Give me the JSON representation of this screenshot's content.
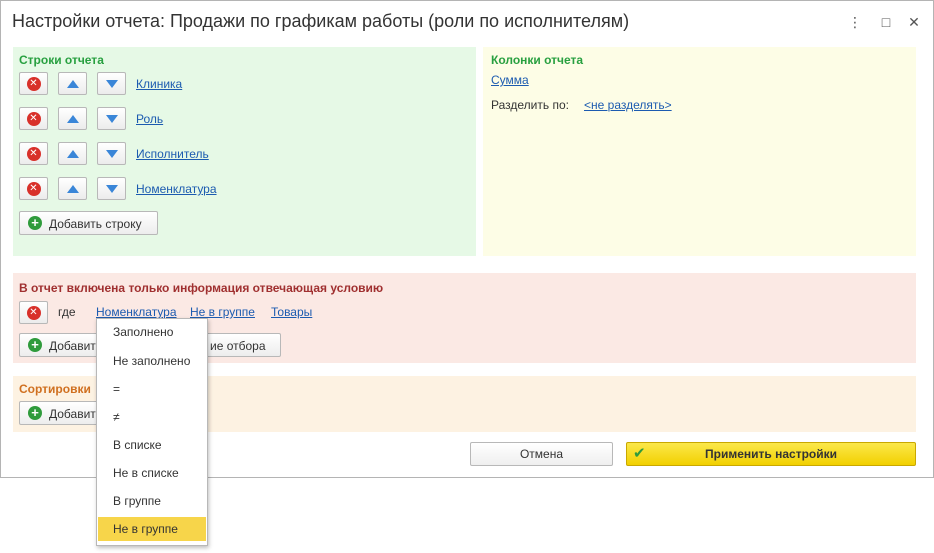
{
  "window": {
    "title": "Настройки отчета: Продажи по графикам работы (роли по исполнителям)",
    "more_glyph": "⋮",
    "maximize_glyph": "□",
    "close_glyph": "✕"
  },
  "rows_panel": {
    "title": "Строки отчета",
    "items": [
      {
        "label": "Клиника"
      },
      {
        "label": "Роль"
      },
      {
        "label": "Исполнитель"
      },
      {
        "label": "Номенклатура"
      }
    ],
    "add_label": "Добавить строку"
  },
  "columns_panel": {
    "title": "Колонки отчета",
    "column_link": "Сумма",
    "split_label": "Разделить по:",
    "split_value": "<не разделять>"
  },
  "filter_panel": {
    "title": "В отчет включена только информация отвечающая условию",
    "where_label": "где",
    "field": "Номенклатура",
    "condition": "Не в группе",
    "value": "Товары",
    "add_label_part1": "Добавить",
    "add_label_part2": "ие отбора"
  },
  "sort_panel": {
    "title": "Сортировки",
    "add_label": "Добавить"
  },
  "footer": {
    "cancel_label": "Отмена",
    "apply_label": "Применить настройки"
  },
  "dropdown": {
    "options": [
      "Заполнено",
      "Не заполнено",
      "=",
      "≠",
      "В списке",
      "Не в списке",
      "В группе",
      "Не в группе"
    ],
    "selected": "Не в группе"
  },
  "colors": {
    "rows_bg": "#e6f9e6",
    "columns_bg": "#fdfde6",
    "filter_bg": "#fbe9e4",
    "sort_bg": "#fdf2e2",
    "link": "#1c5bb0",
    "apply_button": "#f5d60a",
    "selected_option": "#f7d54a"
  },
  "icons": {
    "delete": "delete-icon",
    "move_up": "arrow-up-icon",
    "move_down": "arrow-down-icon",
    "add": "plus-icon",
    "apply": "checkmark-icon"
  }
}
